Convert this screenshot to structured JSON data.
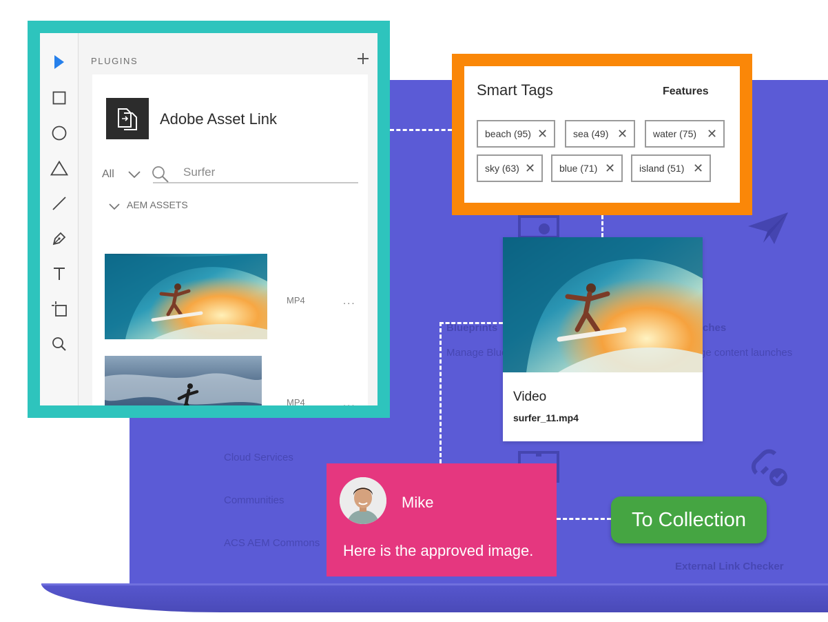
{
  "plugins_panel": {
    "title": "PLUGINS",
    "add_icon": "plus-icon",
    "tools": [
      "select-arrow-icon",
      "rectangle-icon",
      "ellipse-icon",
      "triangle-icon",
      "line-icon",
      "pen-icon",
      "text-icon",
      "artboard-icon",
      "zoom-icon"
    ],
    "plugin_name": "Adobe Asset Link",
    "filter_value": "All",
    "search_placeholder": "Surfer",
    "section_label": "AEM ASSETS",
    "assets": [
      {
        "type": "MP4",
        "more": "..."
      },
      {
        "type": "MP4",
        "more": "..."
      }
    ]
  },
  "smart_tags": {
    "title": "Smart Tags",
    "features": "Features",
    "tags": [
      "beach (95)",
      "sea (49)",
      "water (75)",
      "sky (63)",
      "blue (71)",
      "island (51)"
    ],
    "remove_glyph": "✕"
  },
  "video_card": {
    "title": "Video",
    "filename": "surfer_11.mp4"
  },
  "comment": {
    "name": "Mike",
    "text": "Here is the approved image."
  },
  "collection_button": {
    "label": "To Collection"
  },
  "background": {
    "items": [
      "Blueprints",
      "Manage Blue",
      "ches",
      "ge content launches",
      "Cloud Services",
      "Communities",
      "ACS AEM Commons",
      "External Link Checker"
    ]
  },
  "colors": {
    "screen": "#5b5bd6",
    "plugins_frame": "#2ec4bd",
    "tags_frame": "#fa8708",
    "comment": "#e5377f",
    "collection": "#45a542",
    "selected_tool": "#2680eb"
  }
}
